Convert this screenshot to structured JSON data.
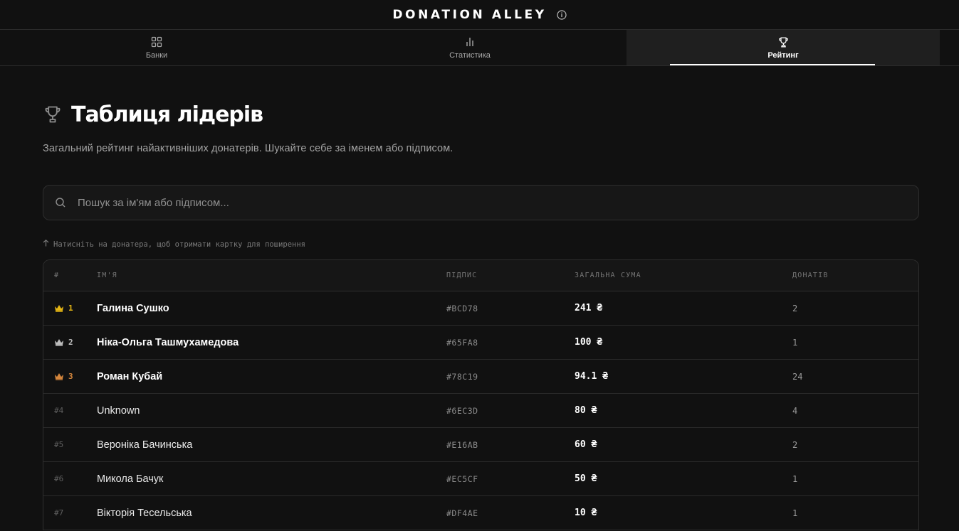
{
  "app": {
    "title": "DONATION ALLEY"
  },
  "tabs": [
    {
      "label": "Банки",
      "icon": "grid-icon",
      "active": false
    },
    {
      "label": "Статистика",
      "icon": "bar-chart-icon",
      "active": false
    },
    {
      "label": "Рейтинг",
      "icon": "trophy-icon",
      "active": true
    }
  ],
  "page": {
    "title": "Таблиця лідерів",
    "subtitle": "Загальний рейтинг найактивніших донатерів. Шукайте себе за іменем або підписом.",
    "search_placeholder": "Пошук за ім'ям або підписом...",
    "hint": "Натисніть на донатера, щоб отримати картку для поширення"
  },
  "table": {
    "headers": {
      "rank": "#",
      "name": "ІМ'Я",
      "signature": "ПІДПИС",
      "total": "ЗАГАЛЬНА СУМА",
      "count": "ДОНАТІВ"
    },
    "rows": [
      {
        "rank": "1",
        "name": "Галина Сушко",
        "signature": "#BCD78",
        "total": "241 ₴",
        "count": "2"
      },
      {
        "rank": "2",
        "name": "Ніка-Ольга Ташмухамедова",
        "signature": "#65FA8",
        "total": "100 ₴",
        "count": "1"
      },
      {
        "rank": "3",
        "name": "Роман Кубай",
        "signature": "#78C19",
        "total": "94.1 ₴",
        "count": "24"
      },
      {
        "rank": "#4",
        "name": "Unknown",
        "signature": "#6EC3D",
        "total": "80 ₴",
        "count": "4"
      },
      {
        "rank": "#5",
        "name": "Вероніка Бачинська",
        "signature": "#E16AB",
        "total": "60 ₴",
        "count": "2"
      },
      {
        "rank": "#6",
        "name": "Микола Бачук",
        "signature": "#EC5CF",
        "total": "50 ₴",
        "count": "1"
      },
      {
        "rank": "#7",
        "name": "Вікторія Тесельська",
        "signature": "#DF4AE",
        "total": "10 ₴",
        "count": "1"
      }
    ]
  },
  "colors": {
    "gold": "#e5b614",
    "silver": "#bdbdbd",
    "bronze": "#d4863c"
  }
}
